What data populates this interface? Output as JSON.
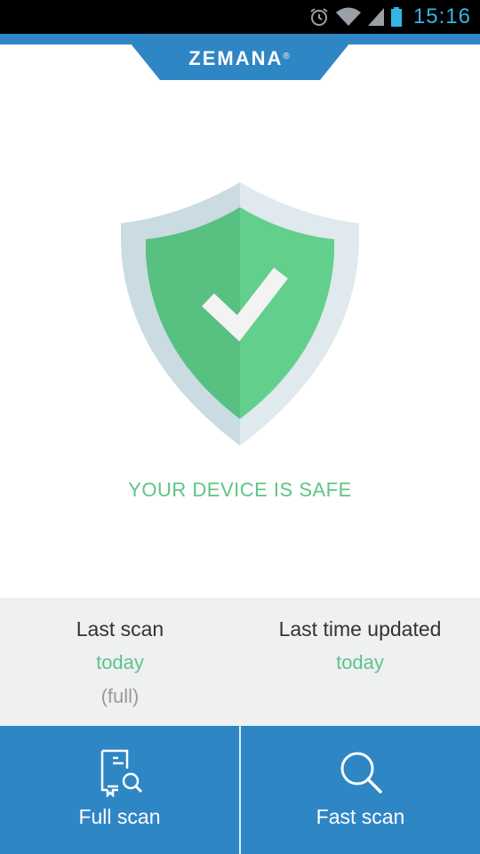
{
  "status_bar": {
    "time": "15:16"
  },
  "header": {
    "brand": "ZEMANA",
    "trademark": "®"
  },
  "main": {
    "status_message": "YOUR DEVICE IS SAFE"
  },
  "info": {
    "last_scan_label": "Last scan",
    "last_scan_value": "today",
    "last_scan_type": "(full)",
    "last_updated_label": "Last time updated",
    "last_updated_value": "today"
  },
  "actions": {
    "full_scan_label": "Full scan",
    "fast_scan_label": "Fast scan"
  },
  "colors": {
    "accent_blue": "#2f86c5",
    "safe_green": "#5ec486",
    "panel_gray": "#eef0f2"
  }
}
